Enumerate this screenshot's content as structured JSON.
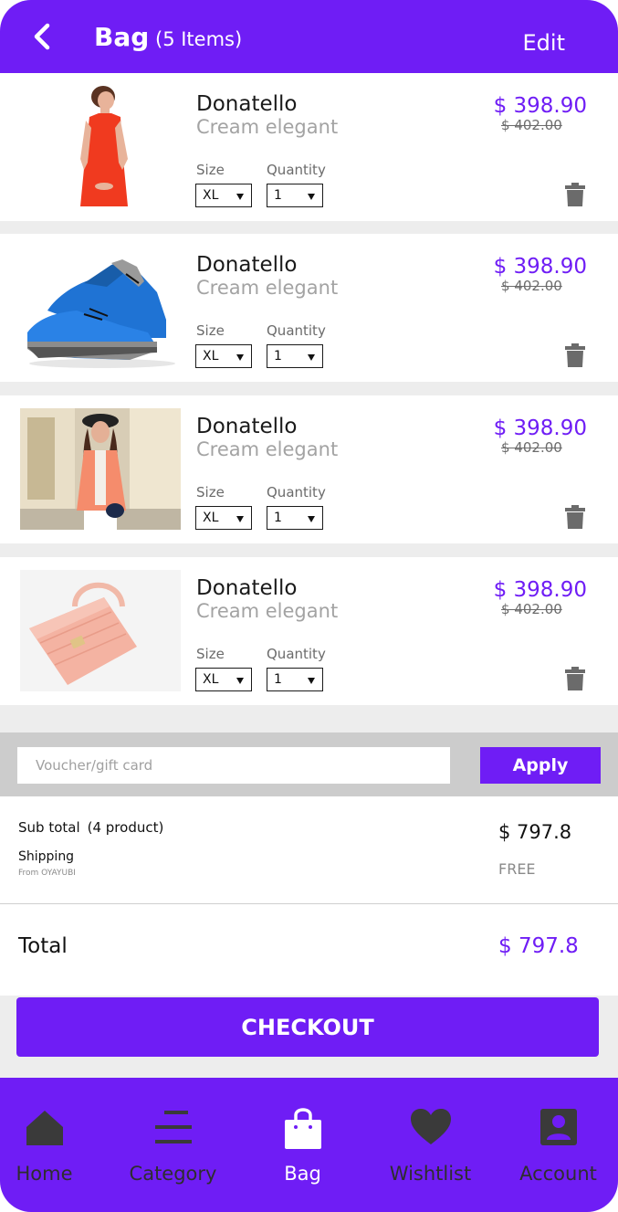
{
  "header": {
    "title": "Bag",
    "item_count": "(5 Items)",
    "edit_label": "Edit"
  },
  "items": [
    {
      "name": "Donatello",
      "subtitle": "Cream elegant",
      "price": "$ 398.90",
      "old_price": "$ 402.00",
      "size_label": "Size",
      "size_value": "XL",
      "quantity_label": "Quantity",
      "quantity_value": "1",
      "image": "red-dress-photo"
    },
    {
      "name": "Donatello",
      "subtitle": "Cream elegant",
      "price": "$ 398.90",
      "old_price": "$ 402.00",
      "size_label": "Size",
      "size_value": "XL",
      "quantity_label": "Quantity",
      "quantity_value": "1",
      "image": "blue-sneakers-photo"
    },
    {
      "name": "Donatello",
      "subtitle": "Cream elegant",
      "price": "$ 398.90",
      "old_price": "$ 402.00",
      "size_label": "Size",
      "size_value": "XL",
      "quantity_label": "Quantity",
      "quantity_value": "1",
      "image": "coral-jacket-photo"
    },
    {
      "name": "Donatello",
      "subtitle": "Cream elegant",
      "price": "$ 398.90",
      "old_price": "$ 402.00",
      "size_label": "Size",
      "size_value": "XL",
      "quantity_label": "Quantity",
      "quantity_value": "1",
      "image": "pink-handbag-photo"
    }
  ],
  "voucher": {
    "placeholder": "Voucher/gift card",
    "apply_label": "Apply"
  },
  "summary": {
    "subtotal_label": "Sub total",
    "subtotal_count": "(4 product)",
    "subtotal_value": "$ 797.8",
    "shipping_label": "Shipping",
    "shipping_from": "From OYAYUBI",
    "shipping_value": "FREE",
    "total_label": "Total",
    "total_value": "$ 797.8"
  },
  "checkout_label": "CHECKOUT",
  "nav": [
    {
      "label": "Home",
      "icon": "home-icon"
    },
    {
      "label": "Category",
      "icon": "category-icon"
    },
    {
      "label": "Bag",
      "icon": "bag-icon",
      "active": true
    },
    {
      "label": "Wishtlist",
      "icon": "heart-icon"
    },
    {
      "label": "Account",
      "icon": "account-icon"
    }
  ],
  "colors": {
    "accent": "#6f1df5",
    "background": "#ededed",
    "muted_text": "#a3a3a3",
    "inactive_nav": "#2e2e2e"
  }
}
